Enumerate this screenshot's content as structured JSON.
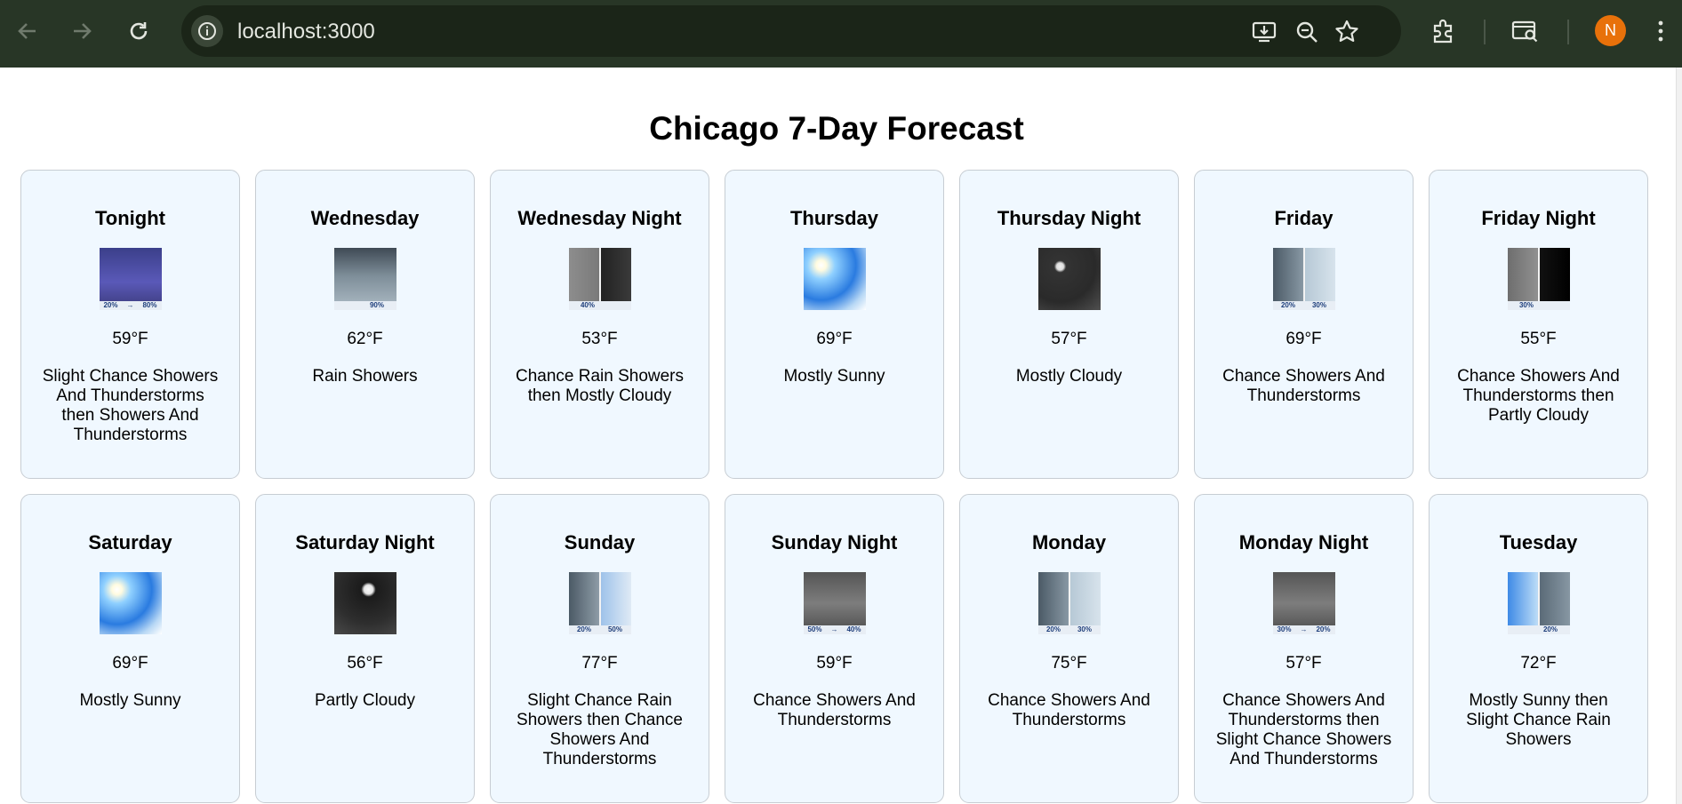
{
  "browser": {
    "url": "localhost:3000",
    "avatar_letter": "N"
  },
  "page": {
    "title": "Chicago 7-Day Forecast"
  },
  "periods": [
    {
      "name": "Tonight",
      "temp": "59°F",
      "desc": "Slight Chance Showers And Thunderstorms then Showers And Thunderstorms",
      "icon": "thunderstorm-icon",
      "pct": [
        "20%",
        "→",
        "80%"
      ]
    },
    {
      "name": "Wednesday",
      "temp": "62°F",
      "desc": "Rain Showers",
      "icon": "rain-showers-icon",
      "pct": [
        "",
        "90%"
      ]
    },
    {
      "name": "Wednesday Night",
      "temp": "53°F",
      "desc": "Chance Rain Showers then Mostly Cloudy",
      "icon": "rain-then-night-cloudy-icon",
      "pct": [
        "40%",
        ""
      ]
    },
    {
      "name": "Thursday",
      "temp": "69°F",
      "desc": "Mostly Sunny",
      "icon": "mostly-sunny-icon",
      "pct": []
    },
    {
      "name": "Thursday Night",
      "temp": "57°F",
      "desc": "Mostly Cloudy",
      "icon": "night-mostly-cloudy-icon",
      "pct": []
    },
    {
      "name": "Friday",
      "temp": "69°F",
      "desc": "Chance Showers And Thunderstorms",
      "icon": "showers-storms-icon",
      "pct": [
        "20%",
        "30%"
      ]
    },
    {
      "name": "Friday Night",
      "temp": "55°F",
      "desc": "Chance Showers And Thunderstorms then Partly Cloudy",
      "icon": "night-storms-then-clear-icon",
      "pct": [
        "30%",
        ""
      ]
    },
    {
      "name": "Saturday",
      "temp": "69°F",
      "desc": "Mostly Sunny",
      "icon": "mostly-sunny-icon",
      "pct": []
    },
    {
      "name": "Saturday Night",
      "temp": "56°F",
      "desc": "Partly Cloudy",
      "icon": "night-partly-cloudy-icon",
      "pct": []
    },
    {
      "name": "Sunday",
      "temp": "77°F",
      "desc": "Slight Chance Rain Showers then Chance Showers And Thunderstorms",
      "icon": "rain-then-storms-icon",
      "pct": [
        "20%",
        "50%"
      ]
    },
    {
      "name": "Sunday Night",
      "temp": "59°F",
      "desc": "Chance Showers And Thunderstorms",
      "icon": "night-storms-icon",
      "pct": [
        "50%",
        "→",
        "40%"
      ]
    },
    {
      "name": "Monday",
      "temp": "75°F",
      "desc": "Chance Showers And Thunderstorms",
      "icon": "showers-storms-icon",
      "pct": [
        "20%",
        "30%"
      ]
    },
    {
      "name": "Monday Night",
      "temp": "57°F",
      "desc": "Chance Showers And Thunderstorms then Slight Chance Showers And Thunderstorms",
      "icon": "night-storms-icon",
      "pct": [
        "30%",
        "→",
        "20%"
      ]
    },
    {
      "name": "Tuesday",
      "temp": "72°F",
      "desc": "Mostly Sunny then Slight Chance Rain Showers",
      "icon": "sunny-then-rain-icon",
      "pct": [
        "",
        "20%"
      ]
    }
  ]
}
